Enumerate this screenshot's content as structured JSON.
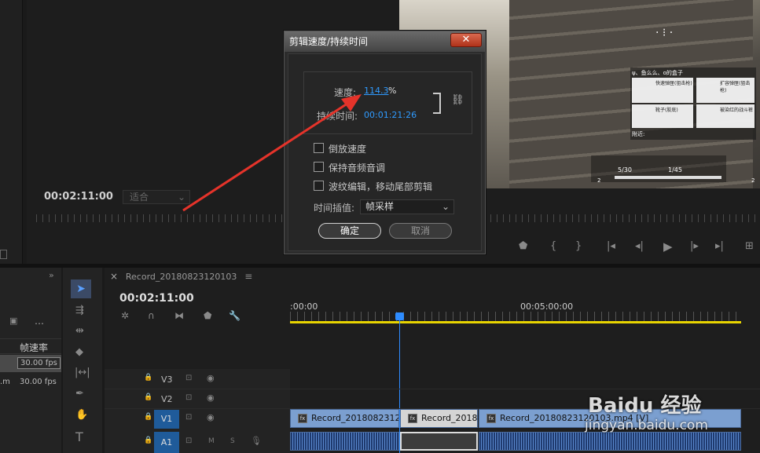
{
  "source_monitor": {
    "timecode": "00:02:11:00",
    "fit_label": "适合"
  },
  "dialog": {
    "title": "剪辑速度/持续时间",
    "close_label": "✕",
    "speed_label": "速度:",
    "speed_value": "114.3",
    "speed_unit": "%",
    "duration_label": "持续时间:",
    "duration_value": "00:01:21:26",
    "reverse_label": "倒放速度",
    "keep_pitch_label": "保持音频音调",
    "ripple_label": "波纹编辑，移动尾部剪辑",
    "interp_label": "时间插值:",
    "interp_value": "帧采样",
    "ok_label": "确定",
    "cancel_label": "取消"
  },
  "project": {
    "col_framerate": "帧速率",
    "rows": [
      "30.00 fps",
      "30.00 fps"
    ],
    "row2_name": ".m"
  },
  "timeline": {
    "tab_close": "×",
    "tab_label": "Record_20180823120103",
    "timecode": "00:02:11:00",
    "ruler_start": ":00:00",
    "ruler_mid": "00:05:00:00",
    "tracks": [
      "V3",
      "V2",
      "V1",
      "A1"
    ],
    "mute": "M",
    "solo": "S",
    "clips": [
      "Record_20180823120103",
      "Record_20180823120103",
      "Record_20180823120103.mp4 [V]"
    ]
  },
  "game_hud": {
    "title": "ψ、鱼么么、o的盒子",
    "items": [
      "快速弹匣(狙击枪)",
      "扩容弹匣(狙击枪)",
      "靴子(胶底)",
      "被染红的战斗裤"
    ],
    "nearby_label": "附近:",
    "ammo1": "5/30",
    "ammo2": "1/45",
    "count1": "2",
    "count2": "2"
  },
  "watermark": {
    "brand": "Baidu 经验",
    "url": "jingyan.baidu.com"
  }
}
